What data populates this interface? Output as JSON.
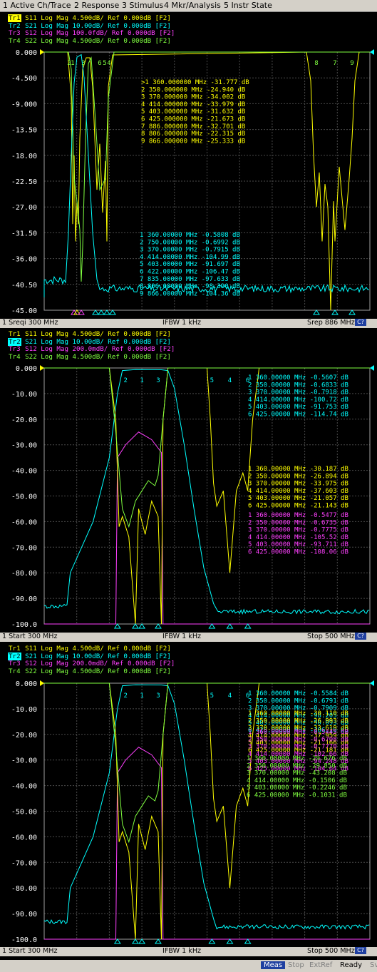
{
  "menu": [
    "1 Active Ch/Trace",
    "2 Response",
    "3 Stimulus",
    "4 Mkr/Analysis",
    "5 Instr State"
  ],
  "colors": {
    "tr1": "#ffff00",
    "tr2": "#00ffff",
    "tr3": "#ff00ff",
    "tr4": "#80ff40",
    "grid": "#505050",
    "axis": "#ffffff"
  },
  "panels": [
    {
      "traces": [
        {
          "tag": "Tr1",
          "text": " S11 Log Mag 4.500dB/ Ref 0.000dB [F2]",
          "color": "#ffff00",
          "active": true
        },
        {
          "tag": "Tr2",
          "text": " S21 Log Mag 10.00dB/ Ref 0.000dB [F2]",
          "color": "#00ffff",
          "active": false
        },
        {
          "tag": "Tr3",
          "text": " S12 Log Mag 100.0fdB/ Ref 0.000dB [F2]",
          "color": "#ff40ff",
          "active": false
        },
        {
          "tag": "Tr4",
          "text": " S22 Log Mag 4.500dB/ Ref 0.000dB [F2]",
          "color": "#80ff40",
          "active": false
        }
      ],
      "y_ticks": [
        "0.000",
        "-4.500",
        "-9.000",
        "-13.50",
        "-18.00",
        "-22.50",
        "-27.00",
        "-31.50",
        "-36.00",
        "-40.50",
        "-45.00"
      ],
      "marker_tables": [
        {
          "color": "#ffff00",
          "rows": [
            ">1  360.000000 MHz -31.777 dB",
            "2  350.000000 MHz -24.940 dB",
            "3  370.000000 MHz -34.002 dB",
            "4  414.000000 MHz -33.979 dB",
            "5  403.000000 MHz -31.632 dB",
            "6  425.000000 MHz -21.673 dB",
            "7  886.000000 MHz -32.701 dB",
            "8  806.000000 MHz -22.315 dB",
            "9  866.000000 MHz -25.333 dB"
          ]
        },
        {
          "color": "#00ffff",
          "rows": [
            "1  360.00000 MHz -0.5808 dB",
            "2  750.00000 MHz -0.6992 dB",
            "3  370.00000 MHz -0.7915 dB",
            "4  414.00000 MHz -104.99 dB",
            "5  403.00000 MHz -91.697 dB",
            "6  422.00000 MHz -106.47 dB",
            "7  835.00000 MHz -97.633 dB",
            "8  806.00000 MHz -98.390 dB",
            "9  866.00000 MHz -104.36 dB"
          ]
        }
      ],
      "status": {
        "left": "1 Sreqi 300 MHz",
        "center": "IFBW 1 kHz",
        "right": "Srep 886 MHz",
        "badge": "C?"
      }
    },
    {
      "traces": [
        {
          "tag": "Tr1",
          "text": " S11 Log Mag 4.500dB/ Ref 0.000dB [F2]",
          "color": "#ffff00",
          "active": false
        },
        {
          "tag": "Tr2",
          "text": " S21 Log Mag 10.00dB/ Ref 0.000dB [F2]",
          "color": "#00ffff",
          "active": true
        },
        {
          "tag": "Tr3",
          "text": " S12 Log Mag 200.0mdB/ Ref 0.000dB [F2]",
          "color": "#ff40ff",
          "active": false
        },
        {
          "tag": "Tr4",
          "text": " S22 Log Mag 4.500dB/ Ref 0.000dB [F2]",
          "color": "#80ff40",
          "active": false
        }
      ],
      "y_ticks": [
        "0.000",
        "-10.00",
        "-20.00",
        "-30.00",
        "-40.00",
        "-50.00",
        "-60.00",
        "-70.00",
        "-80.00",
        "-90.00",
        "-100.0"
      ],
      "marker_tables": [
        {
          "color": "#00ffff",
          "rows": [
            "1  360.00000 MHz -0.5607 dB",
            "2  350.00000 MHz -0.6833 dB",
            "3  370.00000 MHz -0.7918 dB",
            "4  414.00000 MHz -100.72 dB",
            "5  403.00000 MHz -91.753 dB",
            "6  425.00000 MHz -114.74 dB"
          ]
        },
        {
          "color": "#ffff00",
          "rows": [
            "1  360.00000 MHz -30.187 dB",
            "2  350.00000 MHz -26.894 dB",
            "3  370.00000 MHz -33.975 dB",
            "4  414.00000 MHz -37.603 dB",
            "5  403.00000 MHz -21.057 dB",
            "6  425.00000 MHz -21.143 dB"
          ]
        },
        {
          "color": "#ff40ff",
          "rows": [
            "1  360.00000 MHz -0.5477 dB",
            "2  350.00000 MHz -0.6735 dB",
            "3  370.00000 MHz -0.7775 dB",
            "4  414.00000 MHz -105.52 dB",
            "5  403.00000 MHz -93.711 dB",
            "6  425.00000 MHz -108.06 dB"
          ]
        },
        {
          "color": "#80ff40",
          "rows": [
            "1  360.00000 MHz -29.754 dB",
            "2  350.00000 MHz -29.815 dB",
            "3  370.00000 MHz -42.933 dB",
            "4  414.00000 MHz -0.1243 dB",
            "5  403.00000 MHz -0.1523 dB",
            "6  425.00000 MHz -0.1032 dB"
          ]
        }
      ],
      "status": {
        "left": "1 Start 300 MHz",
        "center": "IFBW 1 kHz",
        "right": "Stop 500 MHz",
        "badge": "C?"
      }
    },
    {
      "traces": [
        {
          "tag": "Tr1",
          "text": " S11 Log Mag 4.500dB/ Ref 0.000dB [F2]",
          "color": "#ffff00",
          "active": false
        },
        {
          "tag": "Tr2",
          "text": " S21 Log Mag 10.00dB/ Ref 0.000dB [F2]",
          "color": "#00ffff",
          "active": true
        },
        {
          "tag": "Tr3",
          "text": " S12 Log Mag 200.0mdB/ Ref 0.000dB [F2]",
          "color": "#ff40ff",
          "active": false
        },
        {
          "tag": "Tr4",
          "text": " S22 Log Mag 4.500dB/ Ref 0.000dB [F2]",
          "color": "#80ff40",
          "active": false
        }
      ],
      "y_ticks": [
        "0.000",
        "-10.00",
        "-20.00",
        "-30.00",
        "-40.00",
        "-50.00",
        "-60.00",
        "-70.00",
        "-80.00",
        "-90.00",
        "-100.0"
      ],
      "marker_tables": [
        {
          "color": "#00ffff",
          "rows": [
            "1  360.00000 MHz -0.5584 dB",
            "2  350.00000 MHz -0.6791 dB",
            "3  370.00000 MHz -0.7909 dB",
            "4  414.00000 MHz -98.205 dB",
            "5  403.00000 MHz -90.093 dB",
            "6  425.00000 MHz -106.10 dB"
          ]
        },
        {
          "color": "#ffff00",
          "rows": [
            "1  360.00000 MHz -30.110 dB",
            "2  350.00000 MHz -26.993 dB",
            "3  370.00000 MHz -33.619 dB",
            "4  414.00000 MHz -37.959 dB",
            "5  403.00000 MHz -21.166 dB",
            "6  425.00000 MHz -21.181 dB"
          ]
        },
        {
          "color": "#ff40ff",
          "rows": [
            "1  360.00000 MHz -0.5445 dB",
            "2  350.00000 MHz -0.6708 dB",
            "3  370.00000 MHz -0.7770 dB",
            "4  414.00000 MHz -102.66 dB",
            "5  403.00000 MHz -94.248 dB",
            "6  425.00000 MHz -104.64 dB"
          ]
        },
        {
          "color": "#80ff40",
          "rows": [
            "1  360.00000 MHz -29.676 dB",
            "2  350.00000 MHz -29.850 dB",
            "3  370.00000 MHz -43.208 dB",
            "4  414.00000 MHz -0.1506 dB",
            "5  403.00000 MHz -0.2246 dB",
            "6  425.00000 MHz -0.1031 dB"
          ]
        }
      ],
      "status": {
        "left": "1 Start 300 MHz",
        "center": "IFBW 1 kHz",
        "right": "Stop 500 MHz",
        "badge": "C?"
      }
    }
  ],
  "statusbar": {
    "meas": "Meas",
    "stop": "Stop",
    "extref": "ExtRef",
    "ready": "Ready",
    "svc": "Sv"
  }
}
